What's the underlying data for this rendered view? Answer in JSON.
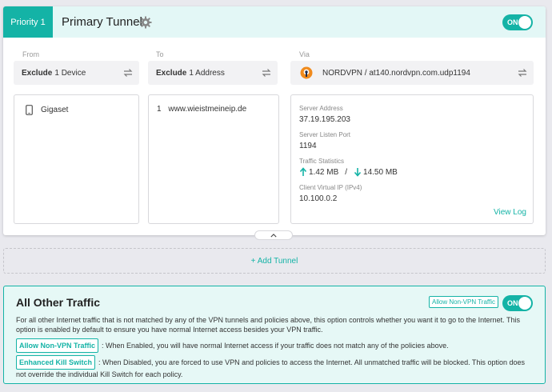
{
  "tunnel": {
    "priority_label": "Priority 1",
    "title": "Primary Tunnel",
    "toggle_label": "ON",
    "from": {
      "label": "From",
      "mode": "Exclude",
      "summary": "1 Device",
      "devices": [
        {
          "name": "Gigaset",
          "icon": "phone-icon"
        }
      ]
    },
    "to": {
      "label": "To",
      "mode": "Exclude",
      "summary": "1 Address",
      "addresses": [
        {
          "index": "1",
          "value": "www.wieistmeineip.de"
        }
      ]
    },
    "via": {
      "label": "Via",
      "provider": "NORDVPN / at140.nordvpn.com.udp1194",
      "server_address_label": "Server Address",
      "server_address": "37.19.195.203",
      "listen_port_label": "Server Listen Port",
      "listen_port": "1194",
      "traffic_label": "Traffic Statistics",
      "upload": "1.42 MB",
      "separator": "/",
      "download": "14.50 MB",
      "client_ip_label": "Client Virtual IP (IPv4)",
      "client_ip": "10.100.0.2",
      "view_log": "View Log"
    }
  },
  "add_tunnel": "+ Add Tunnel",
  "other_traffic": {
    "title": "All Other Traffic",
    "badge": "Allow Non-VPN Traffic",
    "toggle_label": "ON",
    "description": "For all other Internet traffic that is not matched by any of the VPN tunnels and policies above, this option controls whether you want it to go to the Internet. This option is enabled by default to ensure you have normal Internet access besides your VPN traffic.",
    "options": [
      {
        "badge": "Allow Non-VPN Traffic",
        "text": ": When Enabled, you will have normal Internet access if your traffic does not match any of the policies above."
      },
      {
        "badge": "Enhanced Kill Switch",
        "text": ": When Disabled, you are forced to use VPN and policies to access the Internet. All unmatched traffic will be blocked. This option does not override the individual Kill Switch for each policy."
      }
    ]
  },
  "colors": {
    "accent": "#14b3a6",
    "header_bg": "#e3f7f6",
    "page_bg": "#e9e9ee"
  }
}
